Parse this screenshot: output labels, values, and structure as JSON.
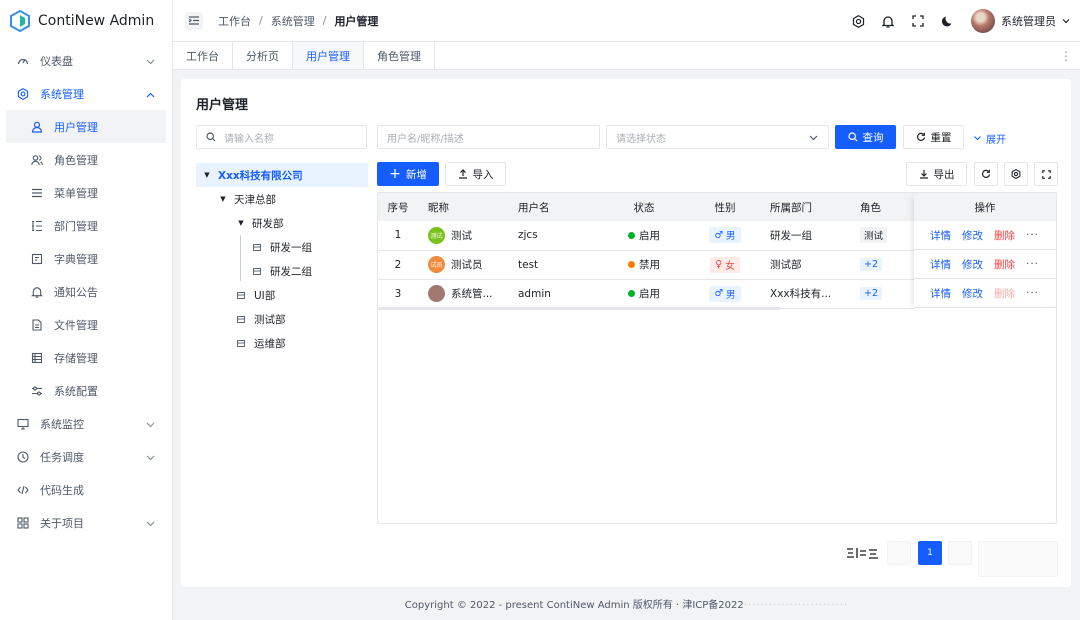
{
  "app": {
    "title": "ContiNew Admin"
  },
  "sidebar": {
    "items": [
      {
        "label": "仪表盘",
        "icon": "dashboard-icon",
        "has_chevron": true
      },
      {
        "label": "系统管理",
        "icon": "settings-icon",
        "has_chevron": true,
        "open": true
      },
      {
        "label": "用户管理",
        "icon": "user-icon",
        "sub": true,
        "active": true
      },
      {
        "label": "角色管理",
        "icon": "users-icon",
        "sub": true
      },
      {
        "label": "菜单管理",
        "icon": "menu-icon",
        "sub": true
      },
      {
        "label": "部门管理",
        "icon": "dept-icon",
        "sub": true
      },
      {
        "label": "字典管理",
        "icon": "dict-icon",
        "sub": true
      },
      {
        "label": "通知公告",
        "icon": "bell-icon",
        "sub": true
      },
      {
        "label": "文件管理",
        "icon": "file-icon",
        "sub": true
      },
      {
        "label": "存储管理",
        "icon": "storage-icon",
        "sub": true
      },
      {
        "label": "系统配置",
        "icon": "config-icon",
        "sub": true
      },
      {
        "label": "系统监控",
        "icon": "monitor-icon",
        "has_chevron": true
      },
      {
        "label": "任务调度",
        "icon": "clock-icon",
        "has_chevron": true
      },
      {
        "label": "代码生成",
        "icon": "code-icon"
      },
      {
        "label": "关于项目",
        "icon": "apps-icon",
        "has_chevron": true
      }
    ]
  },
  "header": {
    "breadcrumb": [
      "工作台",
      "系统管理",
      "用户管理"
    ],
    "user_name": "系统管理员"
  },
  "tabs": [
    {
      "label": "工作台"
    },
    {
      "label": "分析页"
    },
    {
      "label": "用户管理",
      "active": true
    },
    {
      "label": "角色管理"
    }
  ],
  "page": {
    "title": "用户管理",
    "tree_search_placeholder": "请输入名称",
    "filter_placeholder": "用户名/昵称/描述",
    "status_placeholder": "请选择状态",
    "query_label": "查询",
    "reset_label": "重置",
    "expand_label": "展开",
    "add_label": "新增",
    "import_label": "导入",
    "export_label": "导出"
  },
  "tree": [
    {
      "label": "Xxx科技有限公司",
      "level": 0,
      "expanded": true,
      "selected": true
    },
    {
      "label": "天津总部",
      "level": 1,
      "expanded": true
    },
    {
      "label": "研发部",
      "level": 2,
      "expanded": true
    },
    {
      "label": "研发一组",
      "level": 3
    },
    {
      "label": "研发二组",
      "level": 3
    },
    {
      "label": "UI部",
      "level": 2
    },
    {
      "label": "测试部",
      "level": 2
    },
    {
      "label": "运维部",
      "level": 2
    }
  ],
  "table": {
    "headers": [
      "序号",
      "昵称",
      "用户名",
      "状态",
      "性别",
      "所属部门",
      "角色",
      "操作"
    ],
    "rows": [
      {
        "no": "1",
        "nick": "测试",
        "avatar_text": "测试",
        "avatar_color": "#7bc21a",
        "username": "zjcs",
        "status": "启用",
        "status_color": "#00b42a",
        "gender": "男",
        "gender_type": "male",
        "dept": "研发一组",
        "role": "测试",
        "role_blue": false
      },
      {
        "no": "2",
        "nick": "测试员",
        "avatar_text": "试员",
        "avatar_color": "#f08a3c",
        "username": "test",
        "status": "禁用",
        "status_color": "#ff7d00",
        "gender": "女",
        "gender_type": "female",
        "dept": "测试部",
        "role": "+2",
        "role_blue": true
      },
      {
        "no": "3",
        "nick": "系统管...",
        "avatar_text": "",
        "avatar_color": "#a27870",
        "username": "admin",
        "status": "启用",
        "status_color": "#00b42a",
        "gender": "男",
        "gender_type": "male",
        "dept": "Xxx科技有...",
        "role": "+2",
        "role_blue": true
      }
    ],
    "ops": [
      "详情",
      "修改",
      "删除"
    ]
  },
  "pagination": {
    "current": "1"
  },
  "footer": {
    "text": "Copyright © 2022 - present ContiNew Admin 版权所有 · 津ICP备2022"
  },
  "colors": {
    "primary": "#165dff",
    "danger": "#f53f3f",
    "success": "#00b42a",
    "warning": "#ff7d00"
  }
}
